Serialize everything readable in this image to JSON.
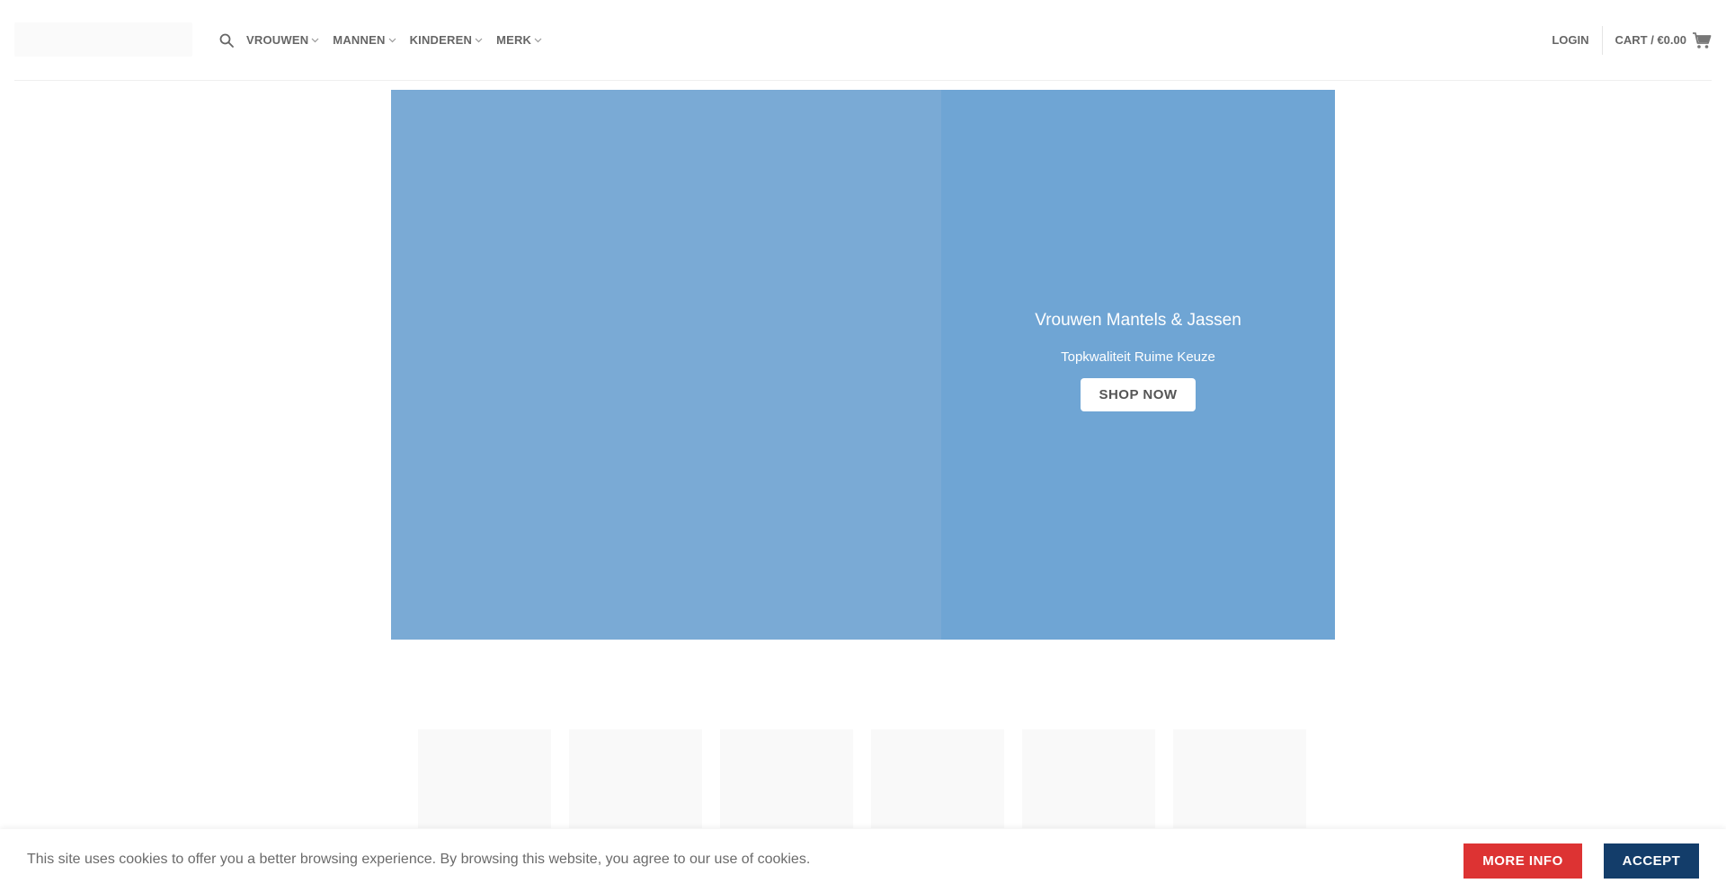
{
  "header": {
    "nav": [
      {
        "label": "VROUWEN"
      },
      {
        "label": "MANNEN"
      },
      {
        "label": "KINDEREN"
      },
      {
        "label": "MERK"
      }
    ],
    "login_label": "LOGIN",
    "cart_label": "CART / €0.00",
    "icons": {
      "search": "search-icon",
      "cart": "cart-icon",
      "dropdown": "chevron-down-icon"
    }
  },
  "hero": {
    "title": "Vrouwen Mantels & Jassen",
    "subtitle": "Topkwaliteit Ruime Keuze",
    "button_label": "SHOP NOW",
    "colors": {
      "left": "#7aaad5",
      "right": "#6fa5d4"
    }
  },
  "cookie_bar": {
    "text": "This site uses cookies to offer you a better browsing experience. By browsing this website, you agree to our use of cookies.",
    "more_info_label": "MORE INFO",
    "accept_label": "ACCEPT",
    "colors": {
      "more_info": "#dd3333",
      "accept": "#133d6a"
    }
  }
}
